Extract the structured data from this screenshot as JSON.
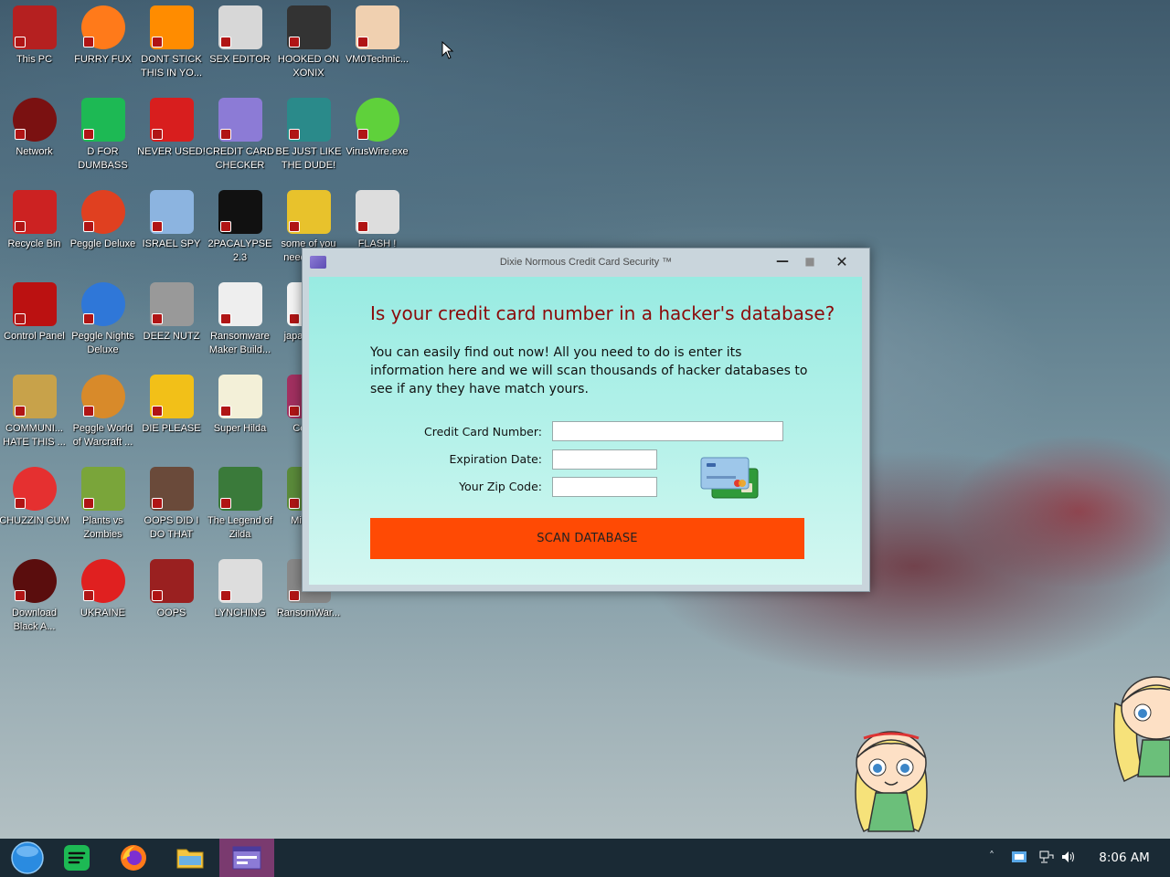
{
  "desktop": {
    "icons": [
      {
        "label": "This PC",
        "icon": "monitor-icon"
      },
      {
        "label": "FURRY FUX",
        "icon": "firefox-icon"
      },
      {
        "label": "DONT STICK THIS IN YO...",
        "icon": "vlc-cone-icon"
      },
      {
        "label": "SEX EDITOR",
        "icon": "hxd-icon"
      },
      {
        "label": "HOOKED ON XONIX",
        "icon": "xonix-icon"
      },
      {
        "label": "VM0Technic...",
        "icon": "doctor-icon"
      },
      {
        "label": "Network",
        "icon": "network-orb-icon"
      },
      {
        "label": "D FOR DUMBASS",
        "icon": "spotify-icon"
      },
      {
        "label": "NEVER USED!",
        "icon": "devcpp-icon"
      },
      {
        "label": "CREDIT CARD CHECKER",
        "icon": "credit-card-window-icon"
      },
      {
        "label": "BE JUST LIKE THE DUDE!",
        "icon": "dude-bowling-icon"
      },
      {
        "label": "VirusWire.exe",
        "icon": "limewire-icon"
      },
      {
        "label": "Recycle Bin",
        "icon": "recycle-bin-icon"
      },
      {
        "label": "Peggle Deluxe",
        "icon": "peggle-icon"
      },
      {
        "label": "ISRAEL SPY",
        "icon": "network-computers-icon"
      },
      {
        "label": "2PACALYPSE 2.3",
        "icon": "cmd-prompt-icon"
      },
      {
        "label": "some of you need t...c...",
        "icon": "dog-cartoon-icon"
      },
      {
        "label": "FLASH !",
        "icon": "flash-icon"
      },
      {
        "label": "Control Panel",
        "icon": "control-panel-icon"
      },
      {
        "label": "Peggle Nights Deluxe",
        "icon": "peggle-nights-icon"
      },
      {
        "label": "DEEZ NUTZ",
        "icon": "stacked-windows-icon"
      },
      {
        "label": "Ransomware Maker Build...",
        "icon": "document-window-icon"
      },
      {
        "label": "japan... s...",
        "icon": "document-icon"
      },
      {
        "label": "COMMUNI... HATE THIS ...",
        "icon": "money-bag-icon"
      },
      {
        "label": "Peggle World of Warcraft ...",
        "icon": "peggle-wow-icon"
      },
      {
        "label": "DIE PLEASE",
        "icon": "adobe-de-icon"
      },
      {
        "label": "Super Hilda",
        "icon": "pixel-game-icon"
      },
      {
        "label": "Colla...",
        "icon": "collab-icon"
      },
      {
        "label": "CHUZZIN CUM",
        "icon": "chuzzle-icon"
      },
      {
        "label": "Plants vs Zombies",
        "icon": "plants-zombies-icon"
      },
      {
        "label": "OOPS DID I DO THAT",
        "icon": "portrait-icon"
      },
      {
        "label": "The Legend of Zilda",
        "icon": "zelda-icon"
      },
      {
        "label": "Minec...",
        "icon": "minecraft-icon"
      },
      {
        "label": "Download Black A...",
        "icon": "black-orb-icon"
      },
      {
        "label": "UKRAINE",
        "icon": "radiation-icon"
      },
      {
        "label": "OOPS",
        "icon": "red-app-icon"
      },
      {
        "label": "LYNCHING",
        "icon": "rope-icon"
      },
      {
        "label": "RansomWar...",
        "icon": "ransomware-icon"
      }
    ]
  },
  "dialog": {
    "title": "Dixie Normous Credit Card Security ™",
    "minimize_glyph": "—",
    "maximize_glyph": "■",
    "close_glyph": "✕",
    "headline": "Is your credit card number in a hacker's database?",
    "intro": "You can easily find out now! All you need to do is enter its information here and we will scan thousands of hacker databases to see if any they have match yours.",
    "fields": {
      "card_number_label": "Credit Card Number:",
      "card_number_value": "",
      "expiration_label": "Expiration Date:",
      "expiration_value": "",
      "zip_label": "Your Zip Code:",
      "zip_value": ""
    },
    "scan_button": "SCAN DATABASE",
    "colors": {
      "headline": "#8b0a0a",
      "button": "#ff4a04",
      "content_bg": "#b7f2ea"
    }
  },
  "taskbar": {
    "items": [
      {
        "name": "start-orb",
        "icon": "start-orb-icon"
      },
      {
        "name": "spotify",
        "icon": "spotify-icon"
      },
      {
        "name": "firefox",
        "icon": "firefox-icon"
      },
      {
        "name": "file-explorer",
        "icon": "folder-icon"
      },
      {
        "name": "credit-card-checker",
        "icon": "credit-card-window-icon"
      }
    ],
    "tray": {
      "chevron": "˄",
      "clock": "8:06 AM"
    },
    "colors": {
      "bar": "#1a2a35",
      "active": "#7a3a6f"
    }
  }
}
